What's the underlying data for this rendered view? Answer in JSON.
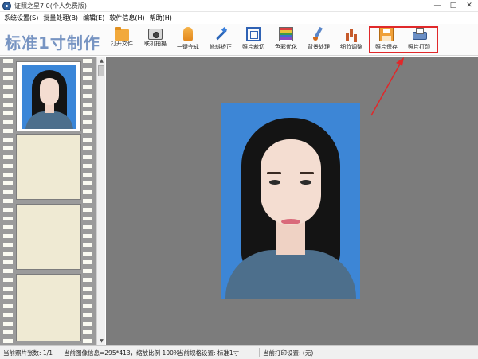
{
  "window": {
    "title": "证照之星7.0(个人免费版)",
    "controls": [
      "—",
      "□",
      "✕"
    ]
  },
  "menu": [
    "系统设置(S)",
    "批量处理(B)",
    "编辑(E)",
    "软件信息(H)",
    "帮助(H)"
  ],
  "toolbar": {
    "brand": "标准1寸制作",
    "tools": [
      {
        "label": "打开文件",
        "icon": "folder-icon"
      },
      {
        "label": "联机拍摄",
        "icon": "camera-icon"
      },
      {
        "label": "一键完成",
        "icon": "hand-icon"
      },
      {
        "label": "修斜矫正",
        "icon": "magic-wand-icon"
      },
      {
        "label": "照片裁切",
        "icon": "crop-icon"
      },
      {
        "label": "色彩优化",
        "icon": "color-palette-icon"
      },
      {
        "label": "背景处理",
        "icon": "brush-icon"
      },
      {
        "label": "细节调整",
        "icon": "bar-chart-icon"
      },
      {
        "label": "照片保存",
        "icon": "save-icon"
      },
      {
        "label": "照片打印",
        "icon": "printer-icon"
      }
    ],
    "highlight_color": "#e0282a"
  },
  "status": {
    "photo_count": "当前照片张数: 1/1",
    "image_info": "当前图像信息=295*413，缩放比例 100%",
    "spec": "当前规格设置: 标准1寸",
    "print": "当前打印设置: (无)"
  }
}
